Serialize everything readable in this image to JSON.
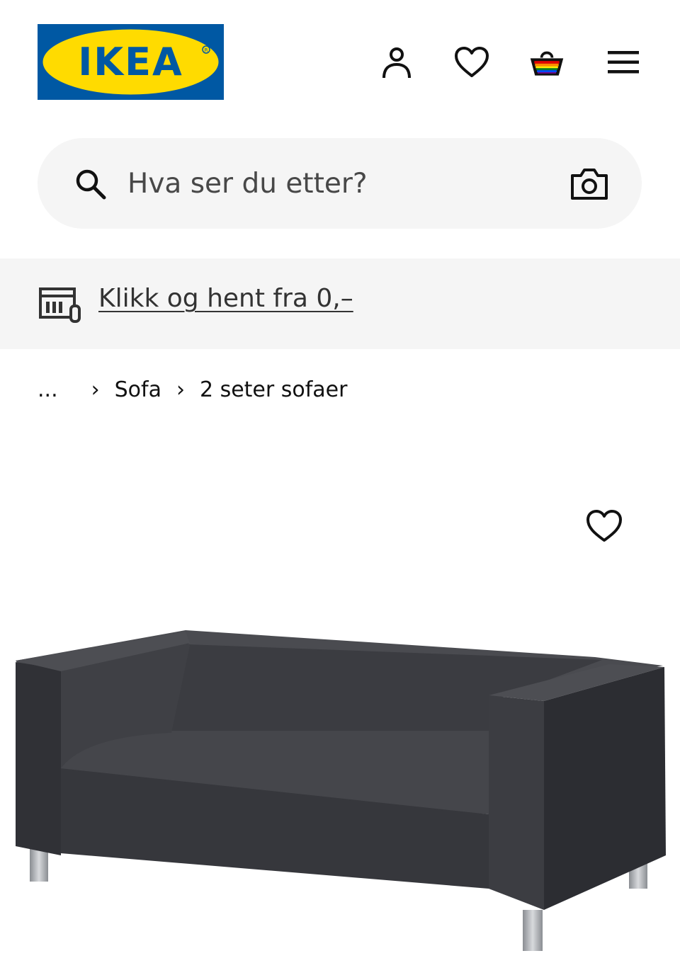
{
  "header": {
    "logo_text": "IKEA",
    "icons": [
      "user-icon",
      "heart-icon",
      "basket-icon",
      "menu-icon"
    ]
  },
  "search": {
    "placeholder": "Hva ser du etter?"
  },
  "promo": {
    "link_text": "Klikk og hent fra 0,–"
  },
  "breadcrumb": {
    "items": [
      "...",
      "Sofa",
      "2 seter sofaer"
    ],
    "separator": "›"
  },
  "colors": {
    "brand_blue": "#0058a3",
    "brand_yellow": "#ffdb00",
    "panel_grey": "#f5f5f5",
    "sofa_grey": "#3a3b40"
  }
}
